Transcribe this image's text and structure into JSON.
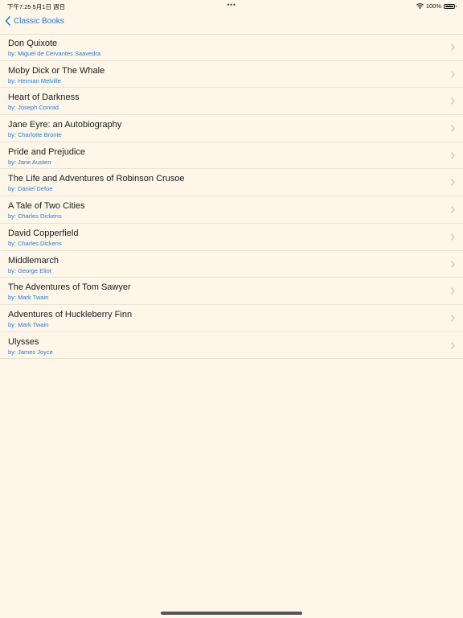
{
  "status_bar": {
    "time_date": "下午7:25   5月1日 週日",
    "more_dots": "•••",
    "battery_text": "100%",
    "battery_level": 1.0
  },
  "nav": {
    "back_label": "Classic Books",
    "accent_color": "#2a7ad1"
  },
  "books": [
    {
      "title": "Don Quixote",
      "author": "by: Miguel de Cervantes Saavedra"
    },
    {
      "title": "Moby Dick or The Whale",
      "author": "by: Herman Melville"
    },
    {
      "title": "Heart of Darkness",
      "author": "by: Joseph Conrad"
    },
    {
      "title": "Jane Eyre: an Autobiography",
      "author": "by: Charlotte Bronte"
    },
    {
      "title": "Pride and Prejudice",
      "author": "by: Jane Austen"
    },
    {
      "title": "The Life and Adventures of Robinson Crusoe",
      "author": "by: Daniel Defoe"
    },
    {
      "title": "A Tale of Two Cities",
      "author": "by: Charles Dickens"
    },
    {
      "title": "David Copperfield",
      "author": "by: Charles Dickens"
    },
    {
      "title": "Middlemarch",
      "author": "by: George Eliot"
    },
    {
      "title": "The Adventures of Tom Sawyer",
      "author": "by: Mark Twain"
    },
    {
      "title": "Adventures of Huckleberry Finn",
      "author": "by: Mark Twain"
    },
    {
      "title": "Ulysses",
      "author": "by: James Joyce"
    }
  ]
}
